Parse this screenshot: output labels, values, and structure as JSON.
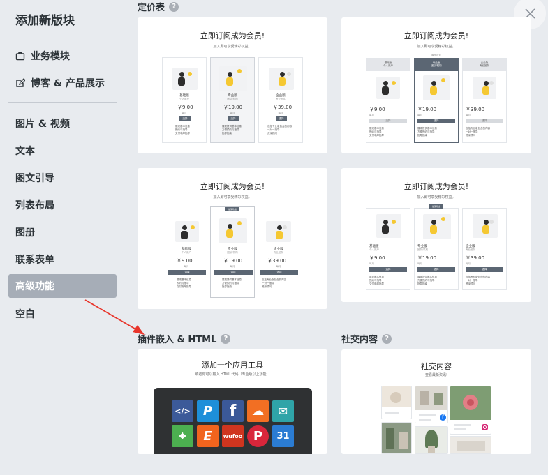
{
  "sidebar": {
    "title": "添加新版块",
    "items": [
      {
        "label": "业务模块",
        "icon": "briefcase-icon"
      },
      {
        "label": "博客 & 产品展示",
        "icon": "edit-icon"
      },
      {
        "label": "图片 & 视频"
      },
      {
        "label": "文本"
      },
      {
        "label": "图文引导"
      },
      {
        "label": "列表布局"
      },
      {
        "label": "图册"
      },
      {
        "label": "联系表单"
      },
      {
        "label": "高级功能"
      },
      {
        "label": "空白"
      }
    ],
    "active": "高级功能"
  },
  "sections": {
    "pricing": {
      "title": "定价表",
      "help": "?"
    },
    "embed": {
      "title": "插件嵌入 & HTML",
      "help": "?"
    },
    "social": {
      "title": "社交内容",
      "help": "?"
    }
  },
  "pricing_card": {
    "title": "立即订阅成为会员!",
    "subtitle": "加入即可享受精彩权益。",
    "featured_badge": "最受欢迎",
    "plans": [
      {
        "name": "基础版",
        "desc": "个人用户",
        "price": "￥9.00",
        "period": "每月",
        "button": "选择",
        "features": "展现基本信息\n预约与指导\n交付电邮指导"
      },
      {
        "name": "专业版",
        "desc": "团队/机构",
        "price": "￥19.00",
        "period": "每月",
        "button": "选择",
        "features": "展现提供基本信息\n方便预约与指导\n指导指南"
      },
      {
        "name": "企业版",
        "desc": "专业团队",
        "price": "￥39.00",
        "period": "每月",
        "button": "选择",
        "features": "包括专业版包含的内容\n一对一指导\n资深顾问"
      }
    ]
  },
  "embed_card": {
    "title": "添加一个应用工具",
    "subtitle": "或者你可以输入 HTML 代码（专业版以上功能）",
    "apps": [
      {
        "icon": "html-code-icon",
        "glyph": "</>",
        "color": "#3c5a99"
      },
      {
        "icon": "paypal-icon",
        "glyph": "P",
        "color": "#1e8fd9"
      },
      {
        "icon": "facebook-icon",
        "glyph": "f",
        "color": "#3b5998"
      },
      {
        "icon": "soundcloud-icon",
        "glyph": "☁",
        "color": "#f26f23"
      },
      {
        "icon": "mailchimp-icon",
        "glyph": "✉",
        "color": "#2fa4a8"
      },
      {
        "icon": "google-maps-icon",
        "glyph": "⌖",
        "color": "#4caf50"
      },
      {
        "icon": "etsy-icon",
        "glyph": "E",
        "color": "#f1641e"
      },
      {
        "icon": "wufoo-icon",
        "glyph": "wufoo",
        "color": "#d0351f"
      },
      {
        "icon": "pinterest-icon",
        "glyph": "P",
        "color": "#d9263b"
      },
      {
        "icon": "calendar-icon",
        "glyph": "31",
        "color": "#2b7cd3"
      }
    ]
  },
  "social_card": {
    "title": "社交内容",
    "subtitle": "查看最新资讯!"
  },
  "close_icon": "close-icon"
}
